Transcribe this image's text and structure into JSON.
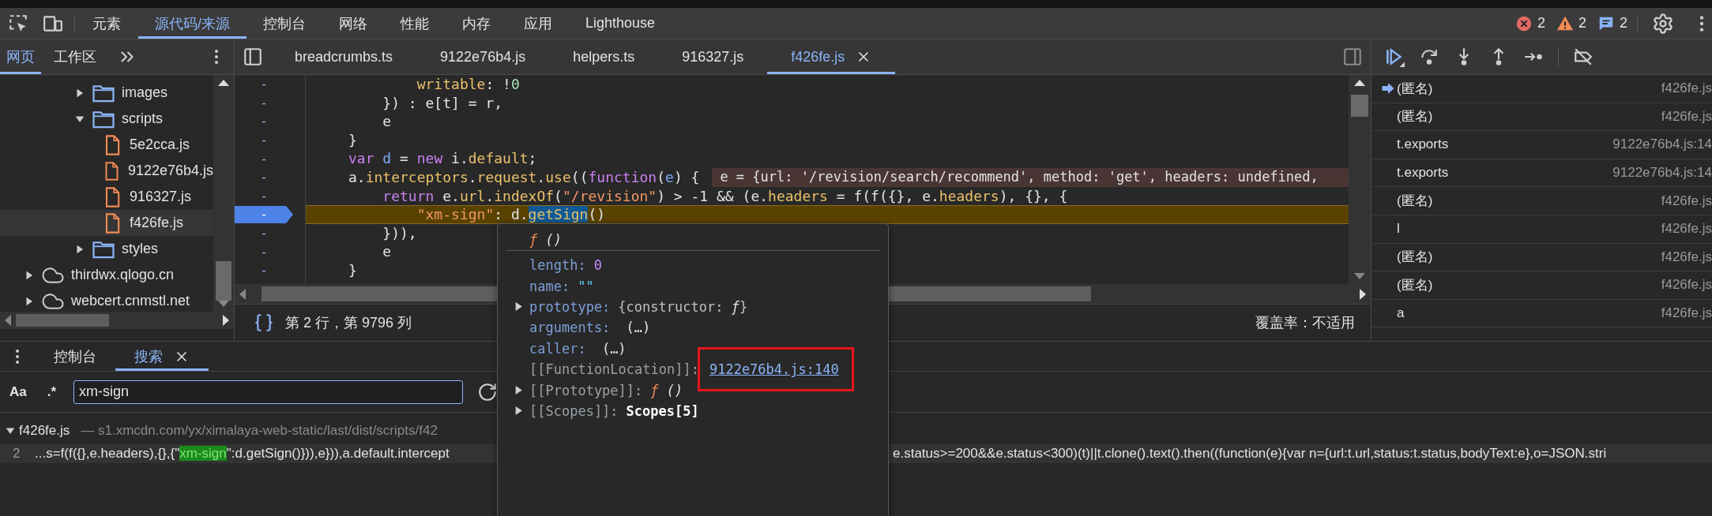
{
  "main_tabs": [
    {
      "label": "元素",
      "selected": false
    },
    {
      "label": "源代码/来源",
      "selected": true
    },
    {
      "label": "控制台",
      "selected": false
    },
    {
      "label": "网络",
      "selected": false
    },
    {
      "label": "性能",
      "selected": false
    },
    {
      "label": "内存",
      "selected": false
    },
    {
      "label": "应用",
      "selected": false
    },
    {
      "label": "Lighthouse",
      "selected": false
    }
  ],
  "status_counts": [
    {
      "kind": "error",
      "count": "2"
    },
    {
      "kind": "warning",
      "count": "2"
    },
    {
      "kind": "message",
      "count": "2"
    }
  ],
  "navigator": {
    "tabs": [
      {
        "label": "网页",
        "selected": true
      },
      {
        "label": "工作区",
        "selected": false
      }
    ]
  },
  "file_tree": [
    {
      "kind": "folder",
      "label": "images",
      "expanded": false,
      "selected": false
    },
    {
      "kind": "folder",
      "label": "scripts",
      "expanded": true,
      "selected": false,
      "children": [
        {
          "kind": "file",
          "label": "5e2cca.js",
          "selected": false
        },
        {
          "kind": "file",
          "label": "9122e76b4.js",
          "selected": false
        },
        {
          "kind": "file",
          "label": "916327.js",
          "selected": false
        },
        {
          "kind": "file",
          "label": "f426fe.js",
          "selected": true
        }
      ]
    },
    {
      "kind": "folder",
      "label": "styles",
      "expanded": false,
      "selected": false
    },
    {
      "kind": "domain",
      "label": "thirdwx.qlogo.cn",
      "expanded": false,
      "selected": false
    },
    {
      "kind": "domain",
      "label": "webcert.cnmstl.net",
      "expanded": false,
      "selected": false
    }
  ],
  "editor": {
    "tabs": [
      {
        "label": "breadcrumbs.ts",
        "selected": false
      },
      {
        "label": "9122e76b4.js",
        "selected": false
      },
      {
        "label": "helpers.ts",
        "selected": false
      },
      {
        "label": "916327.js",
        "selected": false
      },
      {
        "label": "f426fe.js",
        "selected": true
      }
    ],
    "lines": [
      {
        "marker": "-",
        "paused": false,
        "tokens": [
          {
            "kind": "prop",
            "text": "        writable"
          },
          {
            "kind": "plain",
            "text": ": !"
          },
          {
            "kind": "num",
            "text": "0"
          }
        ]
      },
      {
        "marker": "-",
        "paused": false,
        "tokens": [
          {
            "kind": "plain",
            "text": "    }) : e[t] = r,"
          }
        ]
      },
      {
        "marker": "-",
        "paused": false,
        "tokens": [
          {
            "kind": "plain",
            "text": "    e"
          }
        ]
      },
      {
        "marker": "-",
        "paused": false,
        "tokens": [
          {
            "kind": "plain",
            "text": "}"
          }
        ]
      },
      {
        "marker": "-",
        "paused": false,
        "tokens": [
          {
            "kind": "kw",
            "text": "var"
          },
          {
            "kind": "var",
            "text": " d"
          },
          {
            "kind": "plain",
            "text": " = "
          },
          {
            "kind": "kw",
            "text": "new"
          },
          {
            "kind": "plain",
            "text": " i."
          },
          {
            "kind": "prop",
            "text": "default"
          },
          {
            "kind": "plain",
            "text": ";"
          }
        ]
      },
      {
        "marker": "-",
        "paused": false,
        "tokens": [
          {
            "kind": "plain",
            "text": "a."
          },
          {
            "kind": "prop",
            "text": "interceptors"
          },
          {
            "kind": "plain",
            "text": "."
          },
          {
            "kind": "prop",
            "text": "request"
          },
          {
            "kind": "plain",
            "text": "."
          },
          {
            "kind": "prop",
            "text": "use"
          },
          {
            "kind": "plain",
            "text": "(("
          },
          {
            "kind": "kw",
            "text": "function"
          },
          {
            "kind": "plain",
            "text": "("
          },
          {
            "kind": "var",
            "text": "e"
          },
          {
            "kind": "plain",
            "text": ") {"
          }
        ],
        "inline_value": "e = {url: '/revision/search/recommend', method: 'get', headers: undefined,"
      },
      {
        "marker": "-",
        "paused": false,
        "tokens": [
          {
            "kind": "kw",
            "text": "    return"
          },
          {
            "kind": "plain",
            "text": " e."
          },
          {
            "kind": "prop",
            "text": "url"
          },
          {
            "kind": "plain",
            "text": "."
          },
          {
            "kind": "prop",
            "text": "indexOf"
          },
          {
            "kind": "plain",
            "text": "("
          },
          {
            "kind": "str",
            "text": "\"/revision\""
          },
          {
            "kind": "plain",
            "text": ") > -1 && (e."
          },
          {
            "kind": "prop",
            "text": "headers"
          },
          {
            "kind": "plain",
            "text": " = f(f({}, e."
          },
          {
            "kind": "prop",
            "text": "headers"
          },
          {
            "kind": "plain",
            "text": "), {}, {"
          }
        ]
      },
      {
        "marker": "-",
        "paused": true,
        "tokens": [
          {
            "kind": "str",
            "text": "        \"xm-sign\""
          },
          {
            "kind": "plain",
            "text": ": d."
          },
          {
            "kind": "hover",
            "text": "getSign"
          },
          {
            "kind": "plain",
            "text": "()"
          }
        ]
      },
      {
        "marker": "-",
        "paused": false,
        "tokens": [
          {
            "kind": "plain",
            "text": "    })),"
          }
        ]
      },
      {
        "marker": "-",
        "paused": false,
        "tokens": [
          {
            "kind": "plain",
            "text": "    e"
          }
        ]
      },
      {
        "marker": "-",
        "paused": false,
        "tokens": [
          {
            "kind": "plain",
            "text": "}"
          }
        ]
      }
    ],
    "position": "第 2 行，第 9796 列",
    "coverage": "覆盖率：不适用"
  },
  "call_stack": [
    {
      "name": "(匿名)",
      "location": "f426fe.js",
      "current": true
    },
    {
      "name": "(匿名)",
      "location": "f426fe.js",
      "current": false
    },
    {
      "name": "t.exports",
      "location": "9122e76b4.js:14",
      "current": false
    },
    {
      "name": "t.exports",
      "location": "9122e76b4.js:14",
      "current": false
    },
    {
      "name": "(匿名)",
      "location": "f426fe.js",
      "current": false
    },
    {
      "name": "l",
      "location": "f426fe.js",
      "current": false
    },
    {
      "name": "(匿名)",
      "location": "f426fe.js",
      "current": false
    },
    {
      "name": "(匿名)",
      "location": "f426fe.js",
      "current": false
    },
    {
      "name": "a",
      "location": "f426fe.js",
      "current": false
    }
  ],
  "drawer": {
    "tabs": [
      {
        "label": "控制台",
        "selected": false
      },
      {
        "label": "搜索",
        "selected": true
      }
    ],
    "search": {
      "case_label": "Aa",
      "regex_label": ".*",
      "value": "xm-sign"
    },
    "results": [
      {
        "file": "f426fe.js",
        "path": "— s1.xmcdn.com/yx/ximalaya-web-static/last/dist/scripts/f42",
        "expanded": true,
        "matches": [
          {
            "line": "2",
            "left": [
              {
                "text": "...s=f(f({},e.headers),{},{\"",
                "match": false
              },
              {
                "text": "xm-sign",
                "match": true
              },
              {
                "text": "\":d.getSign()})),e})),a.default.intercept",
                "match": false
              }
            ],
            "right": "e.status>=200&&e.status<300)(t)||t.clone().text().then((function(e){var n={url:t.url,status:t.status,bodyText:e},o=JSON.stri"
          }
        ]
      }
    ]
  },
  "popover": {
    "title": [
      {
        "kind": "func",
        "text": "ƒ"
      },
      {
        "kind": "funcargs",
        "text": " ()"
      }
    ],
    "props": [
      {
        "key": "length:",
        "kind": "own",
        "has_children": false,
        "highlighted": false,
        "value": [
          {
            "kind": "number",
            "text": "0"
          }
        ]
      },
      {
        "key": "name:",
        "kind": "own",
        "has_children": false,
        "highlighted": false,
        "value": [
          {
            "kind": "string",
            "text": "\"\""
          }
        ]
      },
      {
        "key": "prototype:",
        "kind": "own",
        "has_children": true,
        "highlighted": false,
        "value": [
          {
            "kind": "dim",
            "text": "{constructor: "
          },
          {
            "kind": "func2",
            "text": "ƒ"
          },
          {
            "kind": "dim",
            "text": "}"
          }
        ]
      },
      {
        "key": "arguments:",
        "kind": "own",
        "has_children": false,
        "highlighted": false,
        "value": [
          {
            "kind": "plain",
            "text": " (…)"
          }
        ]
      },
      {
        "key": "caller:",
        "kind": "own",
        "has_children": false,
        "highlighted": false,
        "value": [
          {
            "kind": "plain",
            "text": " (…)"
          }
        ]
      },
      {
        "key": "[[FunctionLocation]]:",
        "kind": "internal",
        "has_children": false,
        "highlighted": true,
        "value": [
          {
            "kind": "link",
            "text": "9122e76b4.js:140"
          }
        ]
      },
      {
        "key": "[[Prototype]]:",
        "kind": "internal",
        "has_children": true,
        "highlighted": false,
        "value": [
          {
            "kind": "func",
            "text": "ƒ"
          },
          {
            "kind": "funcargs",
            "text": " ()"
          }
        ]
      },
      {
        "key": "[[Scopes]]:",
        "kind": "internal",
        "has_children": true,
        "highlighted": false,
        "value": [
          {
            "kind": "bold",
            "text": "Scopes[5]"
          }
        ]
      }
    ]
  }
}
